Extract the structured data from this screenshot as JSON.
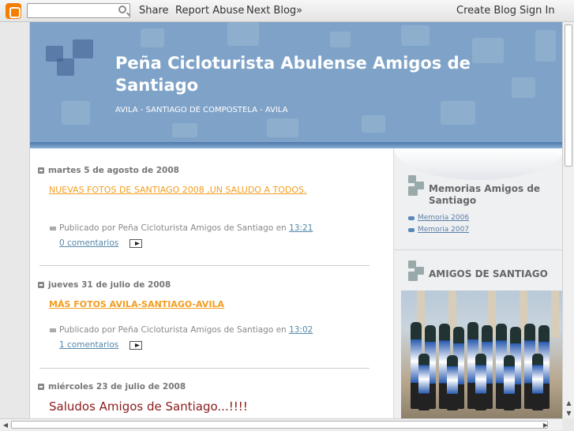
{
  "navbar": {
    "logo": "blogger-logo",
    "search_placeholder": "",
    "links": [
      "Share",
      "Report Abuse",
      "Next Blog»"
    ],
    "right_links": [
      "Create Blog",
      "Sign In"
    ]
  },
  "header": {
    "title": "Peña Cicloturista Abulense Amigos de Santiago",
    "description": "AVILA - SANTIAGO DE COMPOSTELA - AVILA"
  },
  "posts": [
    {
      "date": "martes 5 de agosto de 2008",
      "title": "NUEVAS FOTOS DE SANTIAGO 2008 ,UN SALUDO A TODOS.",
      "footer_prefix": "Publicado por Peña Cicloturista Amigos de Santiago en",
      "time": "13:21",
      "comments": "0 comentarios"
    },
    {
      "date": "jueves 31 de julio de 2008",
      "title": "MÁS FOTOS AVILA-SANTIAGO-AVILA",
      "footer_prefix": "Publicado por Peña Cicloturista Amigos de Santiago en",
      "time": "13:02",
      "comments": "1 comentarios"
    },
    {
      "date": "miércoles 23 de julio de 2008",
      "title": "Saludos Amigos de Santiago...!!!!"
    }
  ],
  "sidebar": {
    "widget1": {
      "title": "Memorias Amigos de Santiago",
      "links": [
        "Memoria 2006",
        "Memoria 2007"
      ]
    },
    "widget2": {
      "title": "AMIGOS DE SANTIAGO"
    }
  },
  "colors": {
    "header_blue": "#7fa3c8",
    "link_orange": "#f29d1f",
    "title_red": "#8b1a1a"
  }
}
